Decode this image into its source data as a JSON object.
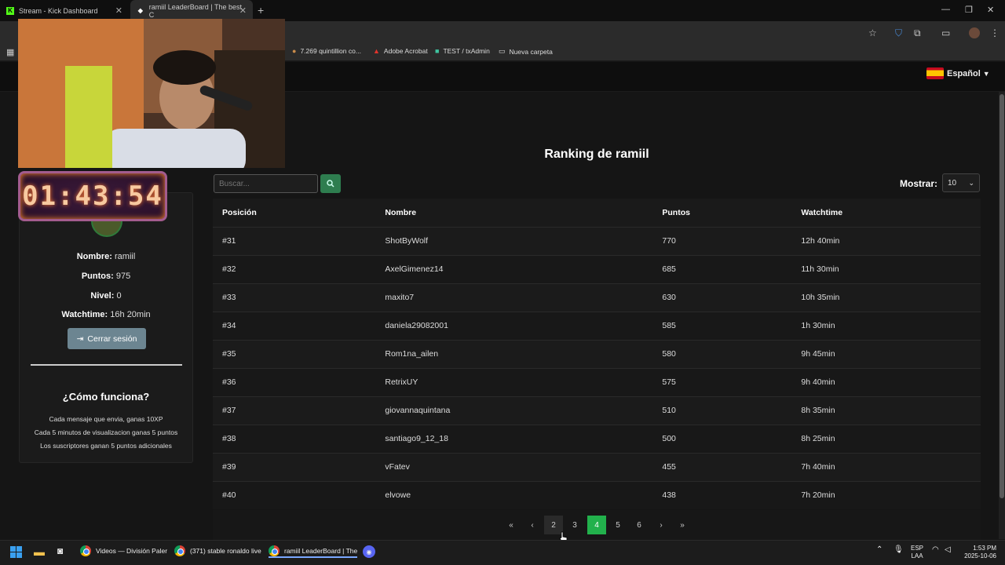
{
  "browser": {
    "tabs": [
      {
        "label": "Stream - Kick Dashboard",
        "favicon": "K"
      },
      {
        "label": "ramiil LeaderBoard | The best C",
        "favicon": "diamond"
      }
    ],
    "new_tab": "+",
    "window_controls": [
      "—",
      "❐",
      "✕"
    ],
    "bookmarks": [
      {
        "label": "7.269 quintillion co..."
      },
      {
        "label": "Adobe Acrobat"
      },
      {
        "label": "TEST / txAdmin"
      },
      {
        "label": "Nueva carpeta"
      }
    ]
  },
  "header": {
    "language": "Español"
  },
  "overlay": {
    "timer": "01:43:54"
  },
  "profile": {
    "name_label": "Nombre:",
    "name_value": "ramiil",
    "points_label": "Puntos:",
    "points_value": "975",
    "level_label": "Nivel:",
    "level_value": "0",
    "watchtime_label": "Watchtime:",
    "watchtime_value": "16h 20min",
    "logout_label": "Cerrar sesión"
  },
  "how": {
    "title": "¿Cómo funciona?",
    "lines": [
      "Cada mensaje que envia, ganas 10XP",
      "Cada 5 minutos de visualizacion ganas 5 puntos",
      "Los suscriptores ganan 5 puntos adicionales"
    ]
  },
  "main": {
    "title": "Ranking de ramiil",
    "search_placeholder": "Buscar...",
    "show_label": "Mostrar:",
    "show_value": "10",
    "columns": [
      "Posición",
      "Nombre",
      "Puntos",
      "Watchtime"
    ],
    "rows": [
      [
        "#31",
        "ShotByWolf",
        "770",
        "12h 40min"
      ],
      [
        "#32",
        "AxelGimenez14",
        "685",
        "11h 30min"
      ],
      [
        "#33",
        "maxito7",
        "630",
        "10h 35min"
      ],
      [
        "#34",
        "daniela29082001",
        "585",
        "1h 30min"
      ],
      [
        "#35",
        "Rom1na_ailen",
        "580",
        "9h 45min"
      ],
      [
        "#36",
        "RetrixUY",
        "575",
        "9h 40min"
      ],
      [
        "#37",
        "giovannaquintana",
        "510",
        "8h 35min"
      ],
      [
        "#38",
        "santiago9_12_18",
        "500",
        "8h 25min"
      ],
      [
        "#39",
        "vFatev",
        "455",
        "7h 40min"
      ],
      [
        "#40",
        "elvowe",
        "438",
        "7h 20min"
      ]
    ],
    "pagination": [
      "«",
      "‹",
      "2",
      "3",
      "4",
      "5",
      "6",
      "›",
      "»"
    ],
    "current_page": "4"
  },
  "taskbar": {
    "items": [
      {
        "label": "Videos — División Paler"
      },
      {
        "label": "(371) stable ronaldo live"
      },
      {
        "label": "ramiil LeaderBoard | The"
      }
    ],
    "lang": "ESP",
    "lang_sub": "LAA",
    "time": "1:53 PM",
    "date": "2025-10-06"
  },
  "colors": {
    "accent": "#22b14c",
    "logout": "#6c8591",
    "search_btn": "#2e7d4f"
  }
}
